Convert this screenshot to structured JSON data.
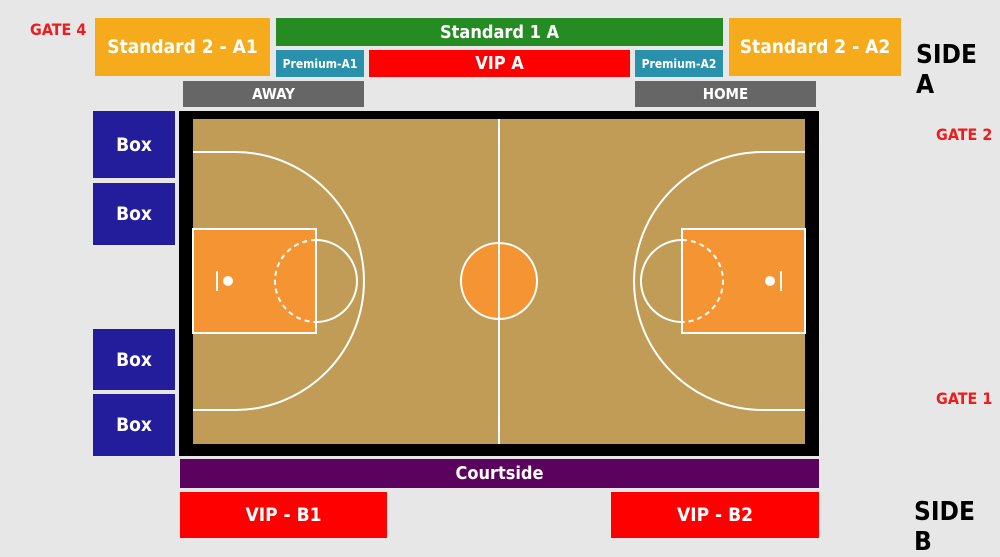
{
  "colors": {
    "background": "#e7e7e7",
    "standard2": "#f6ab1c",
    "standard1": "#248c22",
    "premium": "#2a91ad",
    "vip": "#ff0000",
    "bench": "#666666",
    "box": "#231d9c",
    "courtside": "#5b025e",
    "court_floor": "#c09c56",
    "paint": "#f59432",
    "gate_text": "#ee1c1c"
  },
  "gates": {
    "gate4": "GATE 4",
    "gate2": "GATE 2",
    "gate1": "GATE 1"
  },
  "sides": {
    "side_a": "SIDE A",
    "side_b": "SIDE B"
  },
  "sections": {
    "standard_2_a1": "Standard 2 - A1",
    "standard_1_a": "Standard 1 A",
    "standard_2_a2": "Standard 2 - A2",
    "premium_a1": "Premium-A1",
    "vip_a": "VIP A",
    "premium_a2": "Premium-A2",
    "away": "AWAY",
    "home": "HOME",
    "boxes": [
      "Box",
      "Box",
      "Box",
      "Box"
    ],
    "courtside": "Courtside",
    "vip_b1": "VIP - B1",
    "vip_b2": "VIP - B2"
  }
}
